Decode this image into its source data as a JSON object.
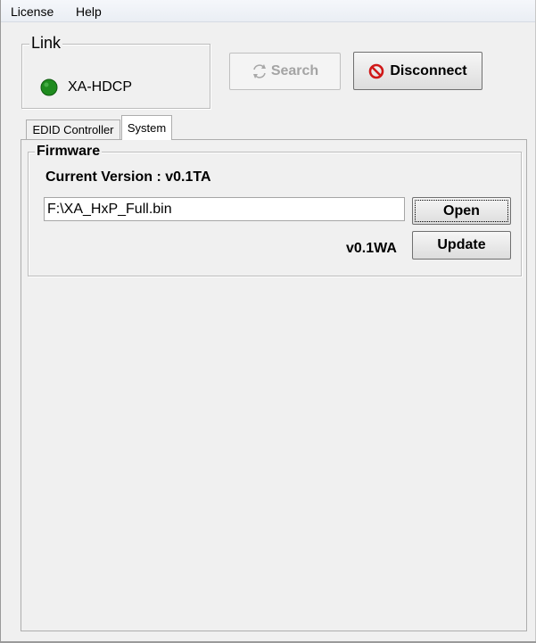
{
  "menu": {
    "items": [
      "License",
      "Help"
    ]
  },
  "link": {
    "legend": "Link",
    "device_name": "XA-HDCP",
    "status_color": "#1a8a1a"
  },
  "buttons": {
    "search_label": "Search",
    "disconnect_label": "Disconnect",
    "open_label": "Open",
    "update_label": "Update"
  },
  "tabs": [
    {
      "label": "EDID Controller",
      "active": false
    },
    {
      "label": "System",
      "active": true
    }
  ],
  "firmware": {
    "legend": "Firmware",
    "current_version_label": "Current Version : v0.1TA",
    "file_path": "F:\\XA_HxP_Full.bin",
    "new_version": "v0.1WA"
  },
  "icons": {
    "search": "refresh-arrows-icon",
    "disconnect": "no-entry-icon",
    "status": "status-led-icon"
  }
}
